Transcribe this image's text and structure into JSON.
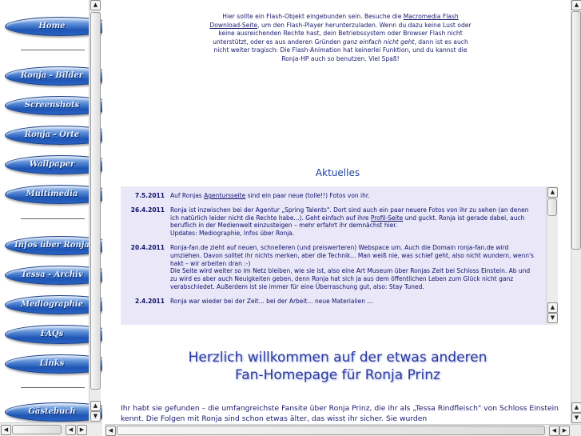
{
  "nav": {
    "items": [
      {
        "label": "Home"
      },
      {
        "label": "Ronja - Bilder"
      },
      {
        "label": "Screenshots"
      },
      {
        "label": "Ronja - Orte"
      },
      {
        "label": "Wallpaper"
      },
      {
        "label": "Multimedia"
      },
      {
        "label": "Infos über Ronja"
      },
      {
        "label": "Tessa - Archiv"
      },
      {
        "label": "Mediographie"
      },
      {
        "label": "FAQs"
      },
      {
        "label": "Links"
      },
      {
        "label": "Gästebuch"
      }
    ]
  },
  "flash_notice": {
    "part1": "Hier sollte ein Flash-Objekt eingebunden sein. Besuche die ",
    "link": "Macromedia Flash Download-Seite",
    "part2": ", um den Flash-Player herunterzuladen. Wenn du dazu keine Lust oder keine ausreichenden Rechte hast, dein Betriebssystem oder Browser Flash nicht unterstützt, oder es aus anderen Gründen ",
    "emph": "ganz einfach nicht geht",
    "part3": ", dann ist es auch nicht weiter tragisch: Die Flash-Animation hat keinerlei Funktion, und du kannst die Ronja-HP auch so benutzen. Viel Spaß!"
  },
  "news": {
    "title": "Aktuelles",
    "items": [
      {
        "date": "7.5.2011",
        "pre": "Auf Ronjas ",
        "link": "Agentursseite",
        "post": " sind ein paar neue (tolle!!) Fotos von ihr."
      },
      {
        "date": "26.4.2011",
        "pre": "Ronja ist inzwischen bei der Agentur „Spring Talents\". Dort sind auch ein paar neuere Fotos von ihr zu sehen (an denen ich natürlich leider nicht die Rechte habe...). Geht einfach auf ihre ",
        "link": "Profil-Seite",
        "post": " und guckt. Ronja ist gerade dabei, auch beruflich in der Medienwelt einzusteigen – mehr erfahrt ihr demnächst hier.",
        "extra": "Updates: Mediographie, Infos über Ronja."
      },
      {
        "date": "20.4.2011",
        "pre": "Ronja-fan.de zieht auf neuen, schnelleren (und preiswerteren) Webspace um. Auch die Domain ronja-fan.de wird umziehen. Davon solltet ihr nichts merken, aber die Technik... Man weiß nie, was schief geht, also nicht wundern, wenn's hakt – wir arbeiten dran :-)",
        "link": "",
        "post": "",
        "extra": "Die Seite wird weiter so im Netz bleiben, wie sie ist, also eine Art Museum über Ronjas Zeit bei Schloss Einstein. Ab und zu wird es aber auch Neuigkeiten geben, denn Ronja hat sich ja aus dem öffentlichen Leben zum Glück nicht ganz verabschiedet. Außerdem ist sie immer für eine Überraschung gut, also: Stay Tuned."
      },
      {
        "date": "2.4.2011",
        "pre": "Ronja war wieder bei der Zeit... bei der Arbeit... neue Materialien ...",
        "link": "",
        "post": ""
      }
    ]
  },
  "welcome": {
    "line1": "Herzlich willkommen auf der etwas anderen",
    "line2": "Fan-Homepage für Ronja Prinz"
  },
  "intro": "Ihr habt sie gefunden – die umfangreichste Fansite über Ronja Prinz, die ihr als „Tessa Rindfleisch\" von Schloss Einstein kennt. Die Folgen mit Ronja sind schon etwas älter, das wisst ihr sicher. Sie wurden"
}
